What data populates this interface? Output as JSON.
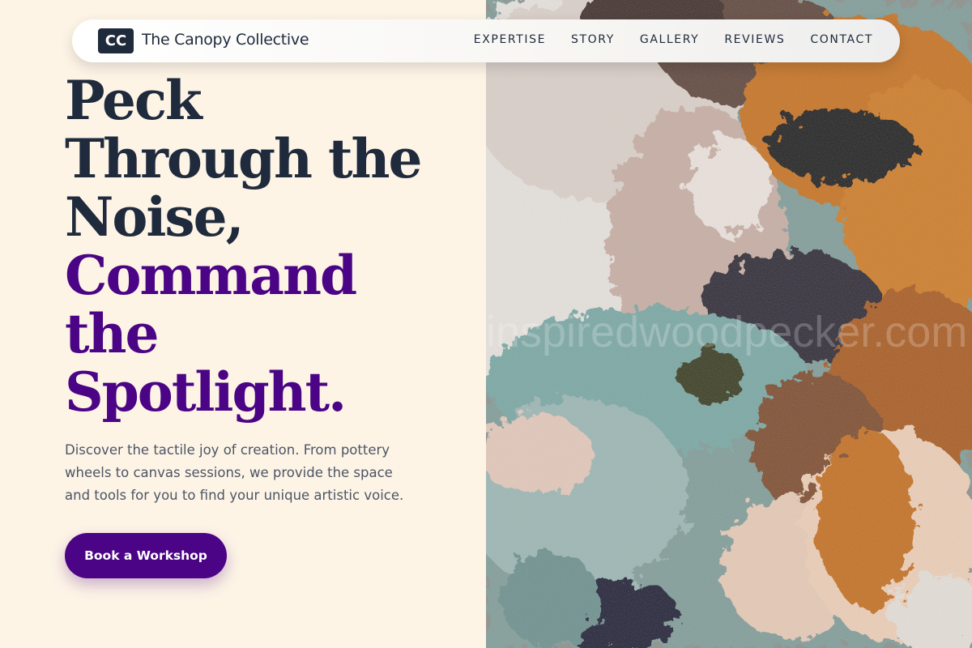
{
  "brand": {
    "logo_text": "CC",
    "name": "The Canopy Collective"
  },
  "nav": {
    "links": [
      "EXPERTISE",
      "STORY",
      "GALLERY",
      "REVIEWS",
      "CONTACT"
    ]
  },
  "hero": {
    "headline_lines": [
      "Peck",
      "Through the",
      "Noise,",
      "Command",
      "the",
      "Spotlight."
    ],
    "subtext": "Discover the tactile joy of creation. From pottery wheels to canvas sessions, we provide the space and tools for you to find your unique artistic voice.",
    "cta_label": "Book a Workshop",
    "image_watermark": "inspiredwoodpecker.com"
  },
  "colors": {
    "dark": "#1f2a3c",
    "accent": "#4b0485",
    "background": "#fdf4e6"
  }
}
